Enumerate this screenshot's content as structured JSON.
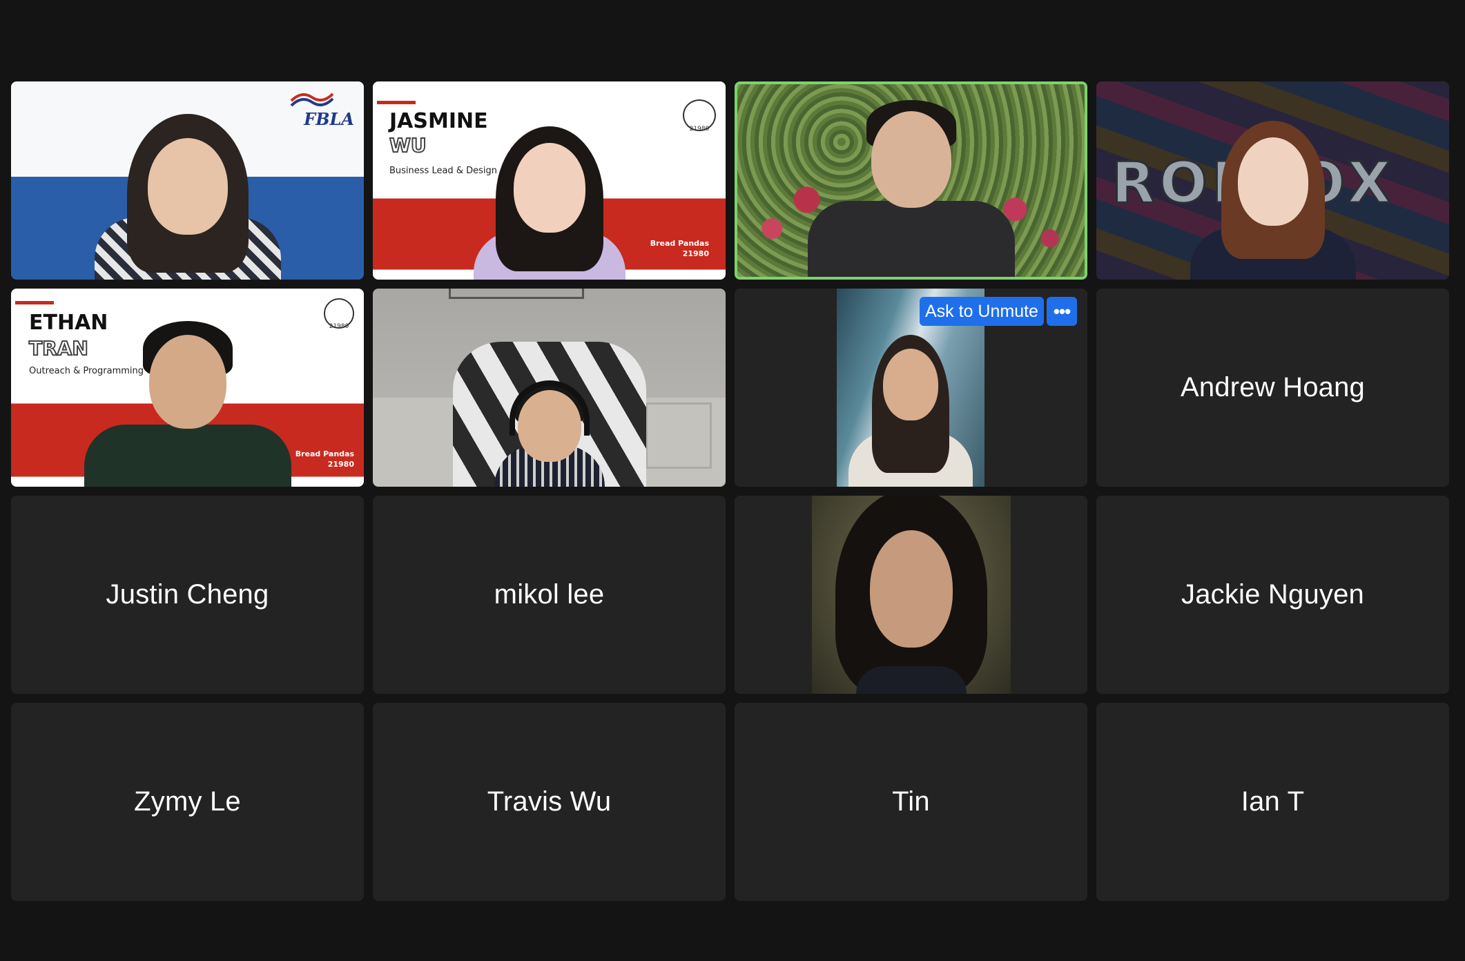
{
  "participants": [
    {
      "id": "p1",
      "type": "video",
      "slide_logo": "FBLA"
    },
    {
      "id": "p2",
      "type": "video",
      "slide_first": "JASMINE",
      "slide_last": "WU",
      "slide_role": "Business Lead & Design",
      "slide_team": "Bread Pandas",
      "slide_number": "21980",
      "panda_label": "21980"
    },
    {
      "id": "p3",
      "type": "video",
      "speaking": true
    },
    {
      "id": "p4",
      "type": "video",
      "background_text": "ROBLOX"
    },
    {
      "id": "p5",
      "type": "video",
      "slide_first": "ETHAN",
      "slide_last": "TRAN",
      "slide_role": "Outreach & Programming",
      "slide_team": "Bread Pandas",
      "slide_number": "21980",
      "panda_label": "21980"
    },
    {
      "id": "p6",
      "type": "video"
    },
    {
      "id": "p7",
      "type": "video",
      "hover_action": "Ask to Unmute"
    },
    {
      "id": "p8",
      "type": "name",
      "name": "Andrew Hoang"
    },
    {
      "id": "p9",
      "type": "name",
      "name": "Justin Cheng"
    },
    {
      "id": "p10",
      "type": "name",
      "name": "mikol lee"
    },
    {
      "id": "p11",
      "type": "video"
    },
    {
      "id": "p12",
      "type": "name",
      "name": "Jackie Nguyen"
    },
    {
      "id": "p13",
      "type": "name",
      "name": "Zymy Le"
    },
    {
      "id": "p14",
      "type": "name",
      "name": "Travis Wu"
    },
    {
      "id": "p15",
      "type": "name",
      "name": "Tin"
    },
    {
      "id": "p16",
      "type": "name",
      "name": "Ian T"
    }
  ],
  "colors": {
    "background": "#141414",
    "tile": "#232323",
    "speaking_border": "#7dd36b",
    "action_button": "#1f6feb",
    "slide_red": "#c82a1f",
    "fbla_blue": "#2a5ea8"
  },
  "icons": {
    "more": "more-horizontal-icon",
    "panda": "red-panda-logo-icon",
    "fbla": "fbla-logo-icon"
  }
}
